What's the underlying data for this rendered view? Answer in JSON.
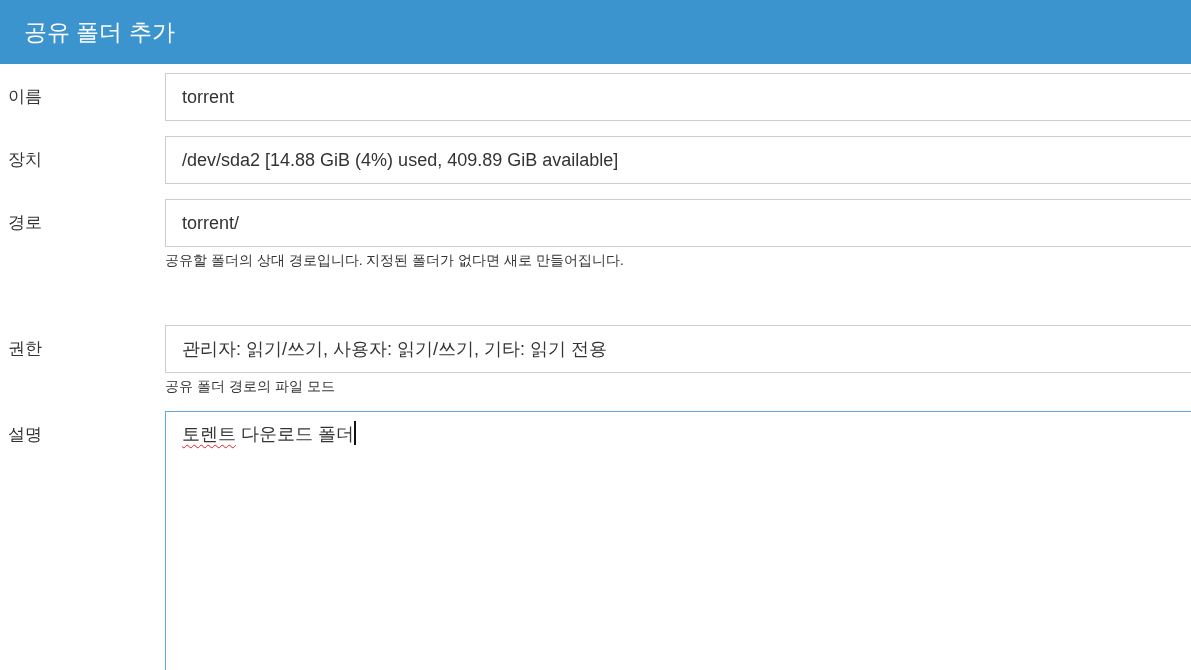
{
  "header": {
    "title": "공유 폴더 추가"
  },
  "fields": [
    {
      "kind": "input",
      "label": "이름",
      "value": "torrent",
      "focused": false
    },
    {
      "kind": "input",
      "label": "장치",
      "value": "/dev/sda2 [14.88 GiB (4%) used, 409.89 GiB available]",
      "focused": false
    },
    {
      "kind": "input",
      "label": "경로",
      "value": "torrent/",
      "focused": false,
      "help": "공유할 폴더의 상대 경로입니다. 지정된 폴더가 없다면 새로 만들어집니다."
    },
    {
      "kind": "input",
      "label": "권한",
      "value": "관리자: 읽기/쓰기, 사용자: 읽기/쓰기, 기타: 읽기 전용",
      "focused": false,
      "help": "공유 폴더 경로의 파일 모드"
    },
    {
      "kind": "textarea",
      "label": "설명",
      "focused": true,
      "value_parts": [
        {
          "text": "토렌트",
          "misspelled": true
        },
        {
          "text": " 다운로드 폴더",
          "misspelled": false
        }
      ]
    }
  ]
}
